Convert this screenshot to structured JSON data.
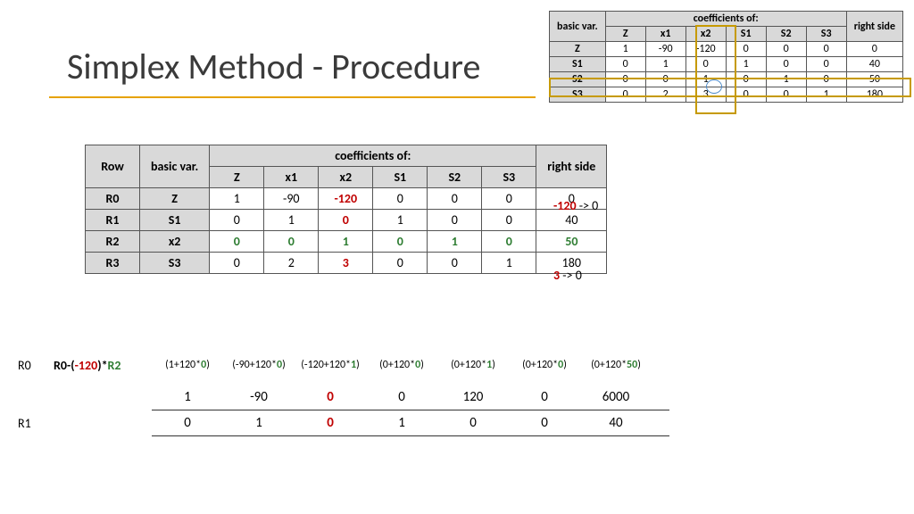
{
  "title": "Simplex Method - Procedure",
  "small": {
    "head_basic": "basic var.",
    "head_coef": "coefficients of:",
    "head_rs": "right side",
    "cols": [
      "Z",
      "x1",
      "x2",
      "S1",
      "S2",
      "S3"
    ],
    "rows": [
      {
        "bv": "Z",
        "v": [
          "1",
          "-90",
          "-120",
          "0",
          "0",
          "0"
        ],
        "rs": "0"
      },
      {
        "bv": "S1",
        "v": [
          "0",
          "1",
          "0",
          "1",
          "0",
          "0"
        ],
        "rs": "40"
      },
      {
        "bv": "S2",
        "v": [
          "0",
          "0",
          "1",
          "0",
          "1",
          "0"
        ],
        "rs": "50"
      },
      {
        "bv": "S3",
        "v": [
          "0",
          "2",
          "3",
          "0",
          "0",
          "1"
        ],
        "rs": "180"
      }
    ]
  },
  "main": {
    "head_row": "Row",
    "head_basic": "basic var.",
    "head_coef": "coefficients of:",
    "head_rs": "right side",
    "cols": [
      "Z",
      "x1",
      "x2",
      "S1",
      "S2",
      "S3"
    ],
    "rows": [
      {
        "r": "R0",
        "bv": "Z",
        "v": [
          "1",
          "-90",
          "-120",
          "0",
          "0",
          "0"
        ],
        "rs": "0",
        "hi": {
          "2": "red"
        }
      },
      {
        "r": "R1",
        "bv": "S1",
        "v": [
          "0",
          "1",
          "0",
          "1",
          "0",
          "0"
        ],
        "rs": "40",
        "hi": {
          "2": "red"
        }
      },
      {
        "r": "R2",
        "bv": "x2",
        "v": [
          "0",
          "0",
          "1",
          "0",
          "1",
          "0"
        ],
        "rs": "50",
        "allgreen": true
      },
      {
        "r": "R3",
        "bv": "S3",
        "v": [
          "0",
          "2",
          "3",
          "0",
          "0",
          "1"
        ],
        "rs": "180",
        "hi": {
          "2": "red"
        }
      }
    ]
  },
  "notes": {
    "n1a": "-120",
    "n1b": " -> 0",
    "n2a": "3",
    "n2b": " -> 0"
  },
  "comp": {
    "r0_label": "R0",
    "r0_formula_a": "R0-(",
    "r0_formula_b": "-120",
    "r0_formula_c": ")*",
    "r0_formula_d": "R2",
    "r0_expr": [
      "(1+120*0)",
      "(-90+120*0)",
      "(-120+120*1)",
      "(0+120*0)",
      "(0+120*1)",
      "(0+120*0)",
      "(0+120*50)"
    ],
    "r0_vals": [
      "1",
      "-90",
      "0",
      "0",
      "120",
      "0",
      "6000"
    ],
    "r1_label": "R1",
    "r1_vals": [
      "0",
      "1",
      "0",
      "1",
      "0",
      "0",
      "40"
    ]
  }
}
